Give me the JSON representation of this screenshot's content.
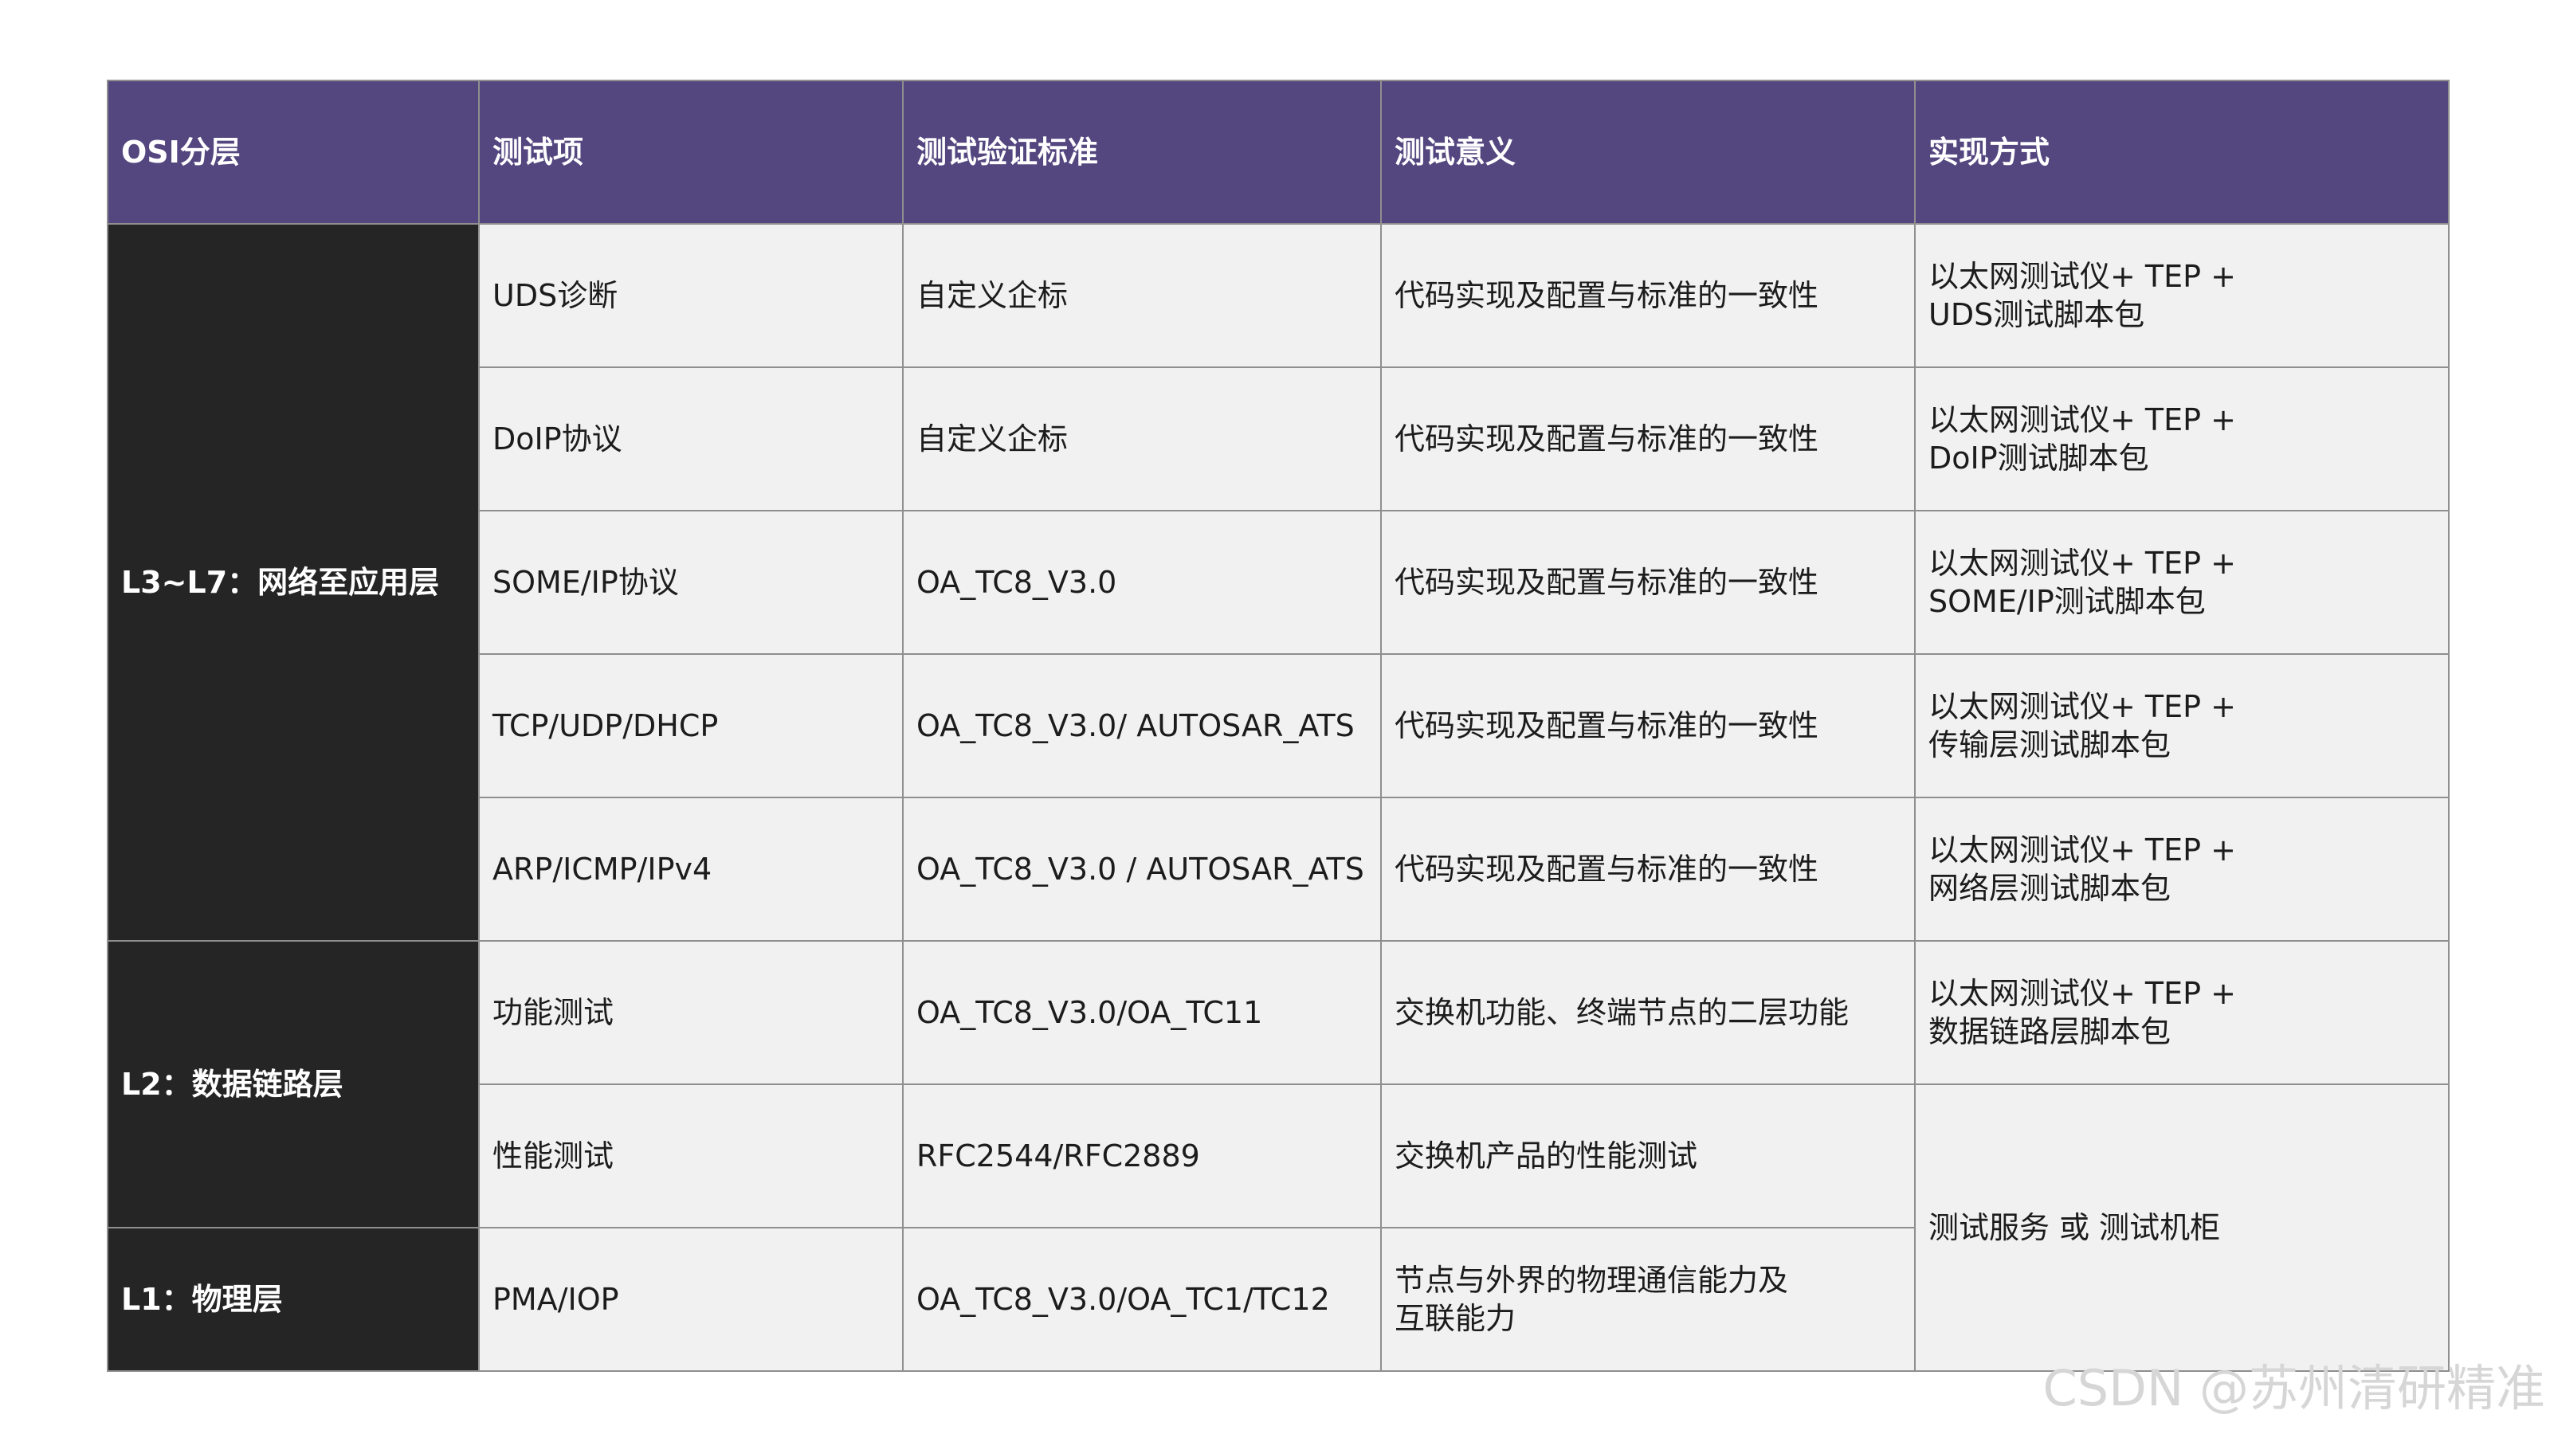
{
  "table": {
    "headers": [
      "OSI分层",
      "测试项",
      "测试验证标准",
      "测试意义",
      "实现方式"
    ],
    "layers": {
      "l3_l7": "L3~L7：网络至应用层",
      "l2": "L2：数据链路层",
      "l1": "L1：物理层"
    },
    "rows": [
      {
        "item": "UDS诊断",
        "standard": "自定义企标",
        "meaning": [
          "代码实现及配置与标准的一致性"
        ],
        "method": [
          "以太网测试仪+ TEP +",
          "UDS测试脚本包"
        ]
      },
      {
        "item": "DoIP协议",
        "standard": "自定义企标",
        "meaning": [
          "代码实现及配置与标准的一致性"
        ],
        "method": [
          "以太网测试仪+ TEP +",
          "DoIP测试脚本包"
        ]
      },
      {
        "item": "SOME/IP协议",
        "standard": "OA_TC8_V3.0",
        "meaning": [
          "代码实现及配置与标准的一致性"
        ],
        "method": [
          "以太网测试仪+ TEP +",
          "SOME/IP测试脚本包"
        ]
      },
      {
        "item": "TCP/UDP/DHCP",
        "standard": "OA_TC8_V3.0/ AUTOSAR_ATS",
        "meaning": [
          "代码实现及配置与标准的一致性"
        ],
        "method": [
          "以太网测试仪+ TEP +",
          "传输层测试脚本包"
        ]
      },
      {
        "item": "ARP/ICMP/IPv4",
        "standard": "OA_TC8_V3.0 / AUTOSAR_ATS",
        "meaning": [
          "代码实现及配置与标准的一致性"
        ],
        "method": [
          "以太网测试仪+ TEP +",
          "网络层测试脚本包"
        ]
      },
      {
        "item": "功能测试",
        "standard": "OA_TC8_V3.0/OA_TC11",
        "meaning": [
          "交换机功能、终端节点的二层功能"
        ],
        "method": [
          "以太网测试仪+ TEP +",
          "数据链路层脚本包"
        ]
      },
      {
        "item": "性能测试",
        "standard": "RFC2544/RFC2889",
        "meaning": [
          "交换机产品的性能测试"
        ],
        "method": [
          "测试服务 或 测试机柜"
        ]
      },
      {
        "item": "PMA/IOP",
        "standard": "OA_TC8_V3.0/OA_TC1/TC12",
        "meaning": [
          "节点与外界的物理通信能力及",
          "互联能力"
        ],
        "method": []
      }
    ]
  },
  "watermark": "CSDN @苏州清研精准"
}
